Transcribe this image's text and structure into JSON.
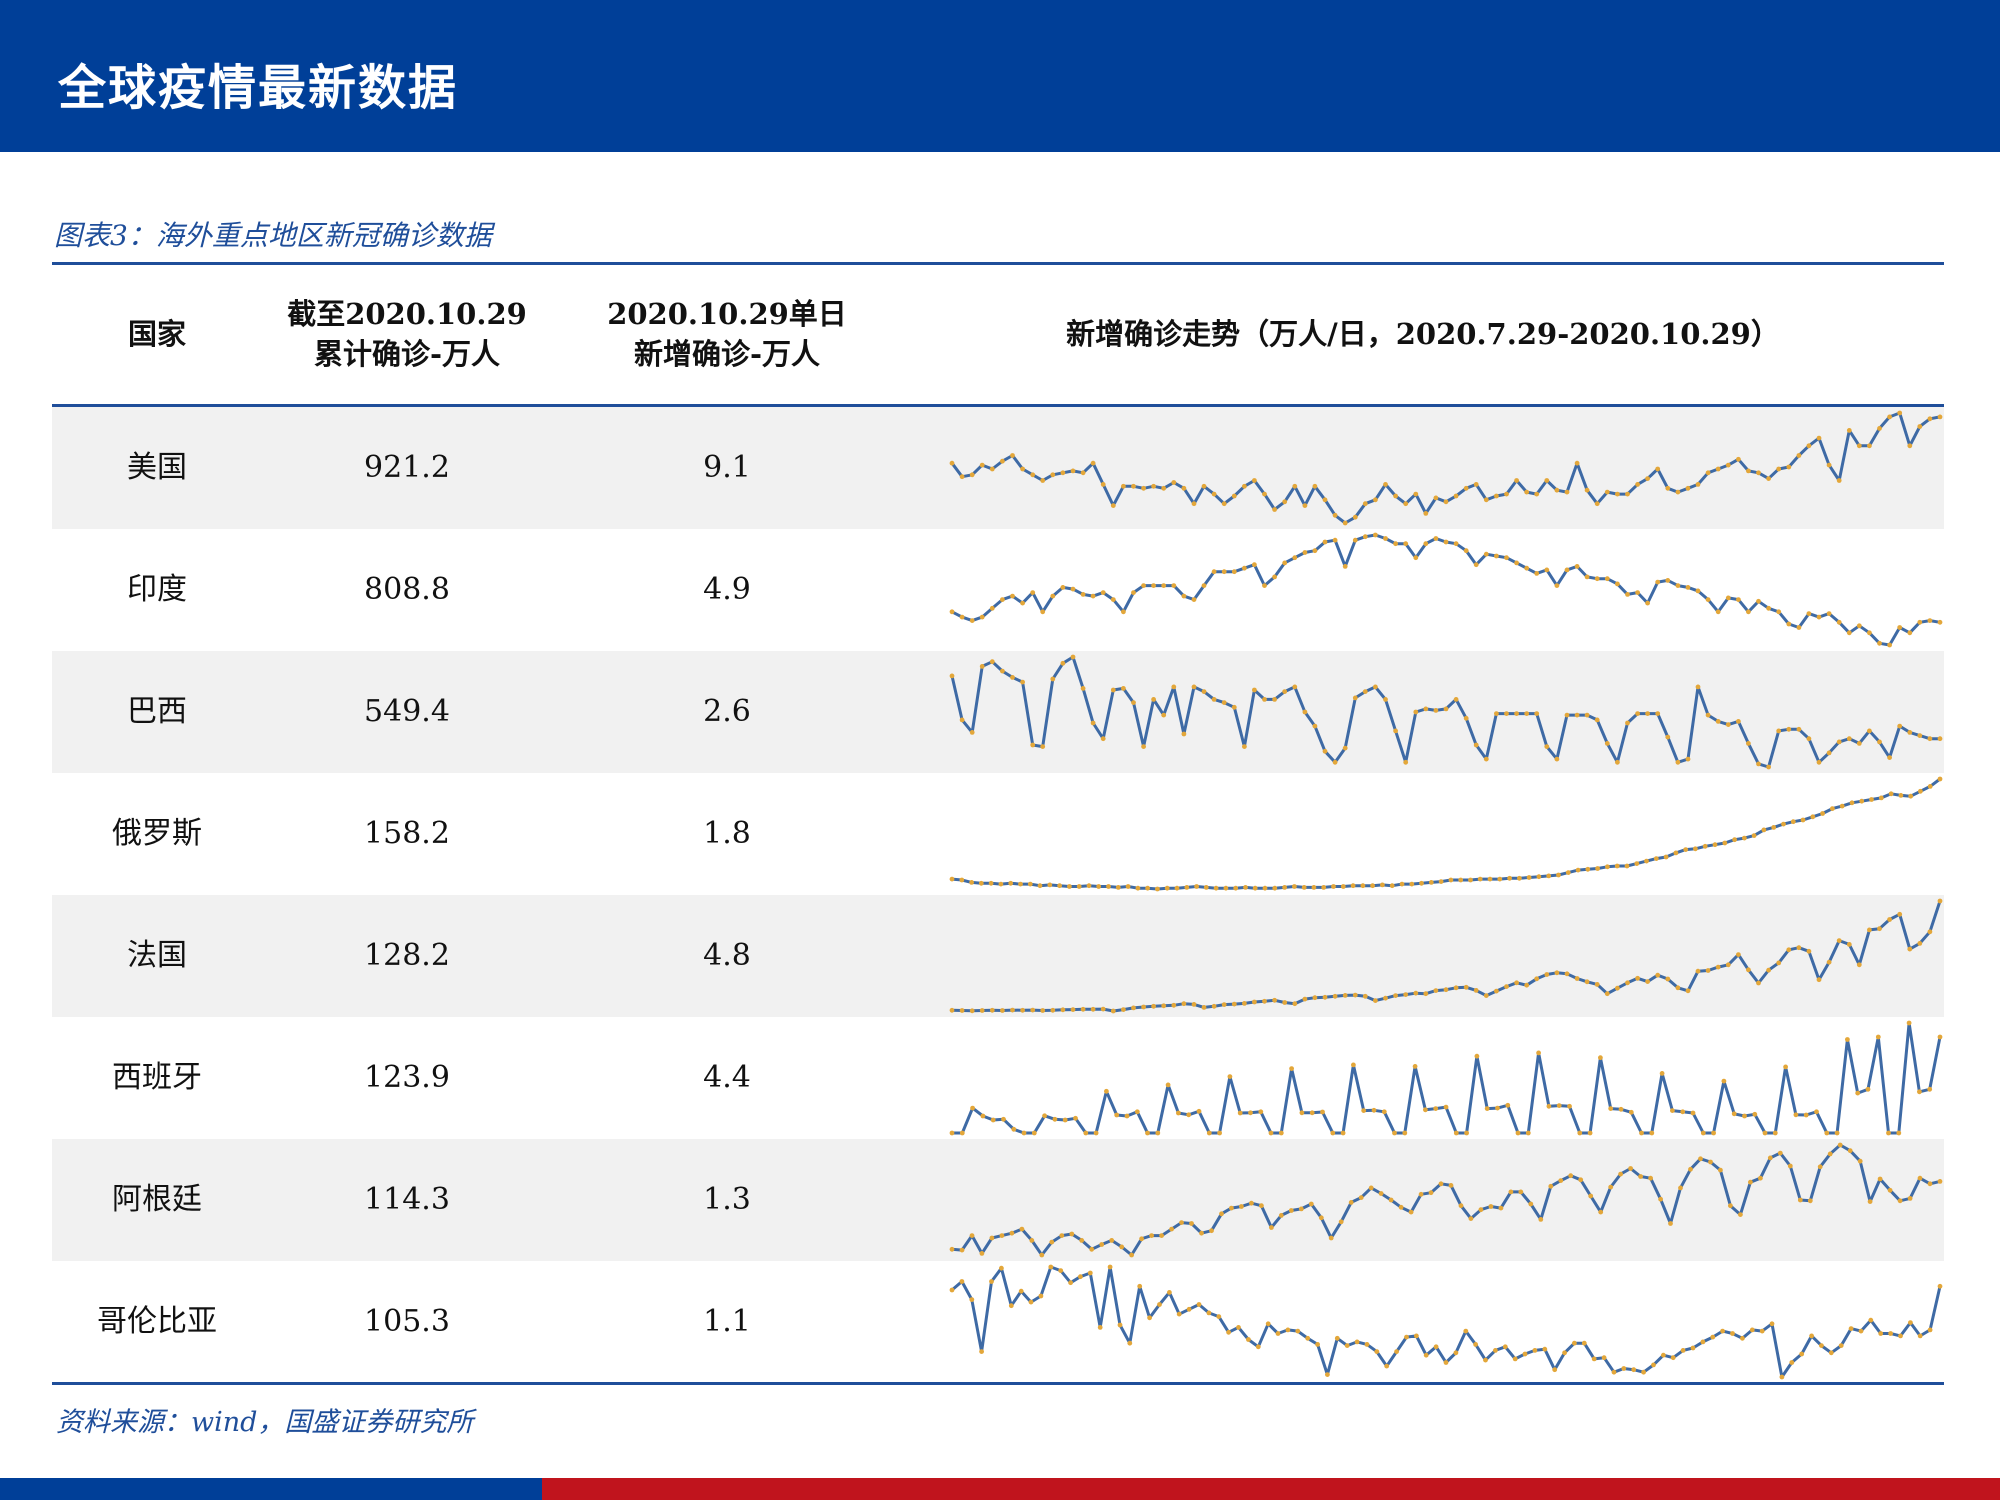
{
  "header": {
    "title": "全球疫情最新数据"
  },
  "figure": {
    "caption": "图表3：海外重点地区新冠确诊数据",
    "source": "资料来源：wind，国盛证券研究所"
  },
  "colors": {
    "line": "#3e6aa5",
    "marker": "#e3a73a",
    "header_bg": "#003f98",
    "footer_red": "#c0141d"
  },
  "chart_data": {
    "type": "table",
    "title": "图表3：海外重点地区新冠确诊数据",
    "columns": [
      {
        "line1": "国家",
        "line2": ""
      },
      {
        "line1": "截至2020.10.29",
        "line2": "累计确诊-万人"
      },
      {
        "line1": "2020.10.29单日",
        "line2": "新增确诊-万人"
      },
      {
        "line1": "新增确诊走势（万人/日，2020.7.29-2020.10.29）",
        "line2": ""
      }
    ],
    "rows": [
      {
        "country": "美国",
        "cumulative": "921.2",
        "daily": "9.1",
        "trend": [
          6.7,
          6.0,
          6.1,
          6.6,
          6.4,
          6.8,
          7.1,
          6.4,
          6.1,
          5.8,
          6.1,
          6.2,
          6.3,
          6.2,
          6.7,
          5.6,
          4.5,
          5.5,
          5.5,
          5.4,
          5.5,
          5.4,
          5.7,
          5.4,
          4.6,
          5.5,
          5.1,
          4.6,
          5.0,
          5.5,
          5.8,
          5.1,
          4.3,
          4.7,
          5.5,
          4.5,
          5.5,
          4.8,
          4.0,
          3.6,
          3.9,
          4.6,
          4.8,
          5.6,
          5.0,
          4.6,
          5.1,
          4.1,
          4.9,
          4.7,
          5.0,
          5.4,
          5.6,
          4.8,
          5.0,
          5.1,
          5.8,
          5.2,
          5.1,
          5.8,
          5.3,
          5.2,
          6.7,
          5.3,
          4.6,
          5.2,
          5.1,
          5.1,
          5.6,
          5.9,
          6.4,
          5.4,
          5.2,
          5.4,
          5.6,
          6.2,
          6.4,
          6.6,
          6.9,
          6.3,
          6.2,
          5.9,
          6.4,
          6.5,
          7.1,
          7.6,
          8.0,
          6.6,
          5.8,
          8.4,
          7.6,
          7.6,
          8.5,
          9.1,
          9.3,
          7.6,
          8.6,
          9.0,
          9.1
        ]
      },
      {
        "country": "印度",
        "cumulative": "808.8",
        "daily": "4.9",
        "trend": [
          5.5,
          5.2,
          5.0,
          5.2,
          5.7,
          6.2,
          6.4,
          6.0,
          6.6,
          5.5,
          6.4,
          6.9,
          6.8,
          6.5,
          6.4,
          6.6,
          6.2,
          5.5,
          6.6,
          7.0,
          7.0,
          7.0,
          7.0,
          6.4,
          6.2,
          7.0,
          7.8,
          7.8,
          7.8,
          8.0,
          8.2,
          7.0,
          7.5,
          8.3,
          8.6,
          8.9,
          9.0,
          9.5,
          9.6,
          8.1,
          9.6,
          9.8,
          9.9,
          9.7,
          9.4,
          9.4,
          8.6,
          9.4,
          9.7,
          9.5,
          9.4,
          9.0,
          8.2,
          8.8,
          8.7,
          8.6,
          8.3,
          8.0,
          7.7,
          7.9,
          7.0,
          7.9,
          8.1,
          7.5,
          7.4,
          7.4,
          7.1,
          6.5,
          6.6,
          6.0,
          7.2,
          7.3,
          7.0,
          6.9,
          6.7,
          6.2,
          5.5,
          6.3,
          6.2,
          5.5,
          6.1,
          5.7,
          5.5,
          4.8,
          4.6,
          5.4,
          5.2,
          5.4,
          4.9,
          4.3,
          4.7,
          4.3,
          3.7,
          3.6,
          4.6,
          4.3,
          4.9,
          5.0,
          4.9
        ]
      },
      {
        "country": "巴西",
        "cumulative": "549.4",
        "daily": "2.6",
        "trend": [
          7.0,
          4.2,
          3.4,
          7.6,
          7.9,
          7.3,
          6.9,
          6.6,
          2.6,
          2.5,
          6.8,
          7.8,
          8.2,
          6.2,
          4.0,
          3.0,
          6.1,
          6.2,
          5.3,
          2.5,
          5.5,
          4.5,
          6.3,
          3.3,
          6.3,
          6.0,
          5.5,
          5.3,
          5.0,
          2.5,
          6.1,
          5.5,
          5.5,
          6.0,
          6.3,
          4.7,
          3.8,
          2.2,
          1.5,
          2.4,
          5.6,
          6.0,
          6.3,
          5.5,
          3.5,
          1.5,
          4.7,
          4.9,
          4.8,
          4.9,
          5.5,
          4.3,
          2.6,
          1.7,
          4.6,
          4.6,
          4.6,
          4.6,
          4.6,
          2.5,
          1.7,
          4.5,
          4.5,
          4.5,
          4.2,
          2.7,
          1.5,
          4.0,
          4.6,
          4.6,
          4.6,
          3.1,
          1.5,
          1.7,
          6.3,
          4.5,
          4.1,
          3.9,
          4.1,
          2.7,
          1.4,
          1.2,
          3.5,
          3.6,
          3.6,
          3.0,
          1.5,
          2.1,
          2.8,
          3.0,
          2.7,
          3.5,
          2.8,
          1.8,
          3.8,
          3.4,
          3.2,
          3.0,
          3.0
        ]
      },
      {
        "country": "俄罗斯",
        "cumulative": "158.2",
        "daily": "1.8",
        "trend": [
          0.57,
          0.56,
          0.53,
          0.52,
          0.52,
          0.51,
          0.52,
          0.51,
          0.51,
          0.49,
          0.5,
          0.49,
          0.48,
          0.48,
          0.49,
          0.48,
          0.48,
          0.47,
          0.48,
          0.46,
          0.46,
          0.45,
          0.46,
          0.46,
          0.47,
          0.48,
          0.47,
          0.46,
          0.46,
          0.46,
          0.47,
          0.46,
          0.46,
          0.46,
          0.47,
          0.48,
          0.47,
          0.47,
          0.47,
          0.48,
          0.48,
          0.49,
          0.49,
          0.49,
          0.5,
          0.49,
          0.51,
          0.51,
          0.52,
          0.53,
          0.54,
          0.56,
          0.56,
          0.56,
          0.57,
          0.57,
          0.57,
          0.58,
          0.58,
          0.59,
          0.6,
          0.61,
          0.62,
          0.65,
          0.68,
          0.69,
          0.7,
          0.72,
          0.73,
          0.73,
          0.76,
          0.79,
          0.82,
          0.84,
          0.89,
          0.93,
          0.94,
          0.97,
          0.99,
          1.01,
          1.05,
          1.07,
          1.1,
          1.17,
          1.2,
          1.24,
          1.27,
          1.29,
          1.33,
          1.37,
          1.43,
          1.46,
          1.5,
          1.52,
          1.54,
          1.56,
          1.61,
          1.59,
          1.58,
          1.64,
          1.7,
          1.79
        ]
      },
      {
        "country": "法国",
        "cumulative": "128.2",
        "daily": "4.8",
        "trend": [
          0.09,
          0.08,
          0.07,
          0.08,
          0.09,
          0.08,
          0.1,
          0.09,
          0.1,
          0.08,
          0.09,
          0.11,
          0.12,
          0.13,
          0.13,
          0.14,
          0.06,
          0.12,
          0.19,
          0.23,
          0.26,
          0.28,
          0.3,
          0.37,
          0.34,
          0.21,
          0.26,
          0.33,
          0.35,
          0.38,
          0.44,
          0.47,
          0.51,
          0.42,
          0.37,
          0.56,
          0.62,
          0.64,
          0.68,
          0.72,
          0.73,
          0.68,
          0.5,
          0.6,
          0.71,
          0.75,
          0.81,
          0.79,
          0.92,
          0.96,
          1.04,
          1.06,
          0.93,
          0.71,
          0.9,
          1.09,
          1.25,
          1.15,
          1.42,
          1.6,
          1.67,
          1.63,
          1.43,
          1.29,
          1.18,
          0.79,
          1.02,
          1.25,
          1.44,
          1.3,
          1.57,
          1.41,
          1.04,
          0.91,
          1.74,
          1.77,
          1.91,
          2.01,
          2.44,
          1.8,
          1.24,
          1.78,
          2.09,
          2.64,
          2.73,
          2.58,
          1.38,
          2.12,
          3.03,
          2.87,
          2.01,
          3.48,
          3.53,
          3.92,
          4.14,
          2.67,
          2.91,
          3.4,
          4.7
        ]
      },
      {
        "country": "西班牙",
        "cumulative": "123.9",
        "daily": "4.4",
        "trend": [
          0.05,
          0.05,
          1.05,
          0.73,
          0.57,
          0.6,
          0.2,
          0.05,
          0.05,
          0.74,
          0.6,
          0.57,
          0.64,
          0.05,
          0.05,
          1.72,
          0.77,
          0.73,
          0.9,
          0.05,
          0.05,
          1.98,
          0.85,
          0.78,
          0.92,
          0.05,
          0.05,
          2.31,
          0.85,
          0.86,
          0.9,
          0.05,
          0.05,
          2.63,
          0.86,
          0.86,
          0.89,
          0.05,
          0.05,
          2.78,
          0.95,
          0.96,
          0.9,
          0.05,
          0.05,
          2.72,
          0.98,
          1.03,
          1.09,
          0.05,
          0.05,
          3.13,
          1.03,
          1.05,
          1.16,
          0.05,
          0.05,
          3.26,
          1.12,
          1.15,
          1.12,
          0.05,
          0.05,
          3.07,
          1.03,
          1.0,
          0.88,
          0.05,
          0.05,
          2.44,
          0.95,
          0.9,
          0.85,
          0.05,
          0.05,
          2.13,
          0.82,
          0.73,
          0.8,
          0.05,
          0.05,
          2.7,
          0.78,
          0.77,
          0.9,
          0.05,
          0.05,
          3.8,
          1.65,
          1.8,
          3.9,
          0.05,
          0.05,
          4.46,
          1.7,
          1.8,
          3.9
        ]
      },
      {
        "country": "阿根廷",
        "cumulative": "114.3",
        "daily": "1.3",
        "trend": [
          0.47,
          0.46,
          0.64,
          0.42,
          0.61,
          0.64,
          0.67,
          0.72,
          0.58,
          0.4,
          0.56,
          0.64,
          0.66,
          0.58,
          0.47,
          0.53,
          0.58,
          0.5,
          0.4,
          0.6,
          0.64,
          0.64,
          0.72,
          0.8,
          0.79,
          0.67,
          0.7,
          0.91,
          0.98,
          1.0,
          1.04,
          1.01,
          0.74,
          0.89,
          0.95,
          0.97,
          1.03,
          0.86,
          0.61,
          0.81,
          1.05,
          1.11,
          1.23,
          1.16,
          1.08,
          0.99,
          0.93,
          1.15,
          1.17,
          1.28,
          1.26,
          1.01,
          0.85,
          0.96,
          1.0,
          0.98,
          1.18,
          1.18,
          1.03,
          0.84,
          1.25,
          1.32,
          1.38,
          1.33,
          1.13,
          0.93,
          1.24,
          1.4,
          1.47,
          1.37,
          1.35,
          1.09,
          0.79,
          1.23,
          1.46,
          1.59,
          1.55,
          1.45,
          1.01,
          0.9,
          1.3,
          1.35,
          1.6,
          1.66,
          1.5,
          1.08,
          1.07,
          1.49,
          1.65,
          1.76,
          1.69,
          1.56,
          1.06,
          1.34,
          1.2,
          1.07,
          1.1,
          1.35,
          1.28,
          1.31
        ]
      },
      {
        "country": "哥伦比亚",
        "cumulative": "105.3",
        "daily": "1.1",
        "trend": [
          1.06,
          1.13,
          0.98,
          0.55,
          1.13,
          1.24,
          0.93,
          1.05,
          0.96,
          1.01,
          1.25,
          1.22,
          1.12,
          1.17,
          1.2,
          0.75,
          1.25,
          0.77,
          0.62,
          1.09,
          0.83,
          0.94,
          1.04,
          0.86,
          0.9,
          0.94,
          0.87,
          0.84,
          0.71,
          0.75,
          0.65,
          0.59,
          0.78,
          0.7,
          0.73,
          0.72,
          0.66,
          0.61,
          0.36,
          0.66,
          0.6,
          0.63,
          0.61,
          0.55,
          0.43,
          0.55,
          0.67,
          0.68,
          0.52,
          0.59,
          0.46,
          0.54,
          0.72,
          0.61,
          0.48,
          0.56,
          0.59,
          0.49,
          0.53,
          0.56,
          0.57,
          0.4,
          0.54,
          0.62,
          0.62,
          0.49,
          0.5,
          0.38,
          0.41,
          0.4,
          0.38,
          0.44,
          0.52,
          0.5,
          0.56,
          0.58,
          0.63,
          0.67,
          0.72,
          0.7,
          0.66,
          0.73,
          0.72,
          0.78,
          0.34,
          0.46,
          0.53,
          0.68,
          0.6,
          0.54,
          0.6,
          0.74,
          0.72,
          0.81,
          0.7,
          0.7,
          0.68,
          0.79,
          0.68,
          0.73,
          1.09
        ]
      }
    ]
  }
}
